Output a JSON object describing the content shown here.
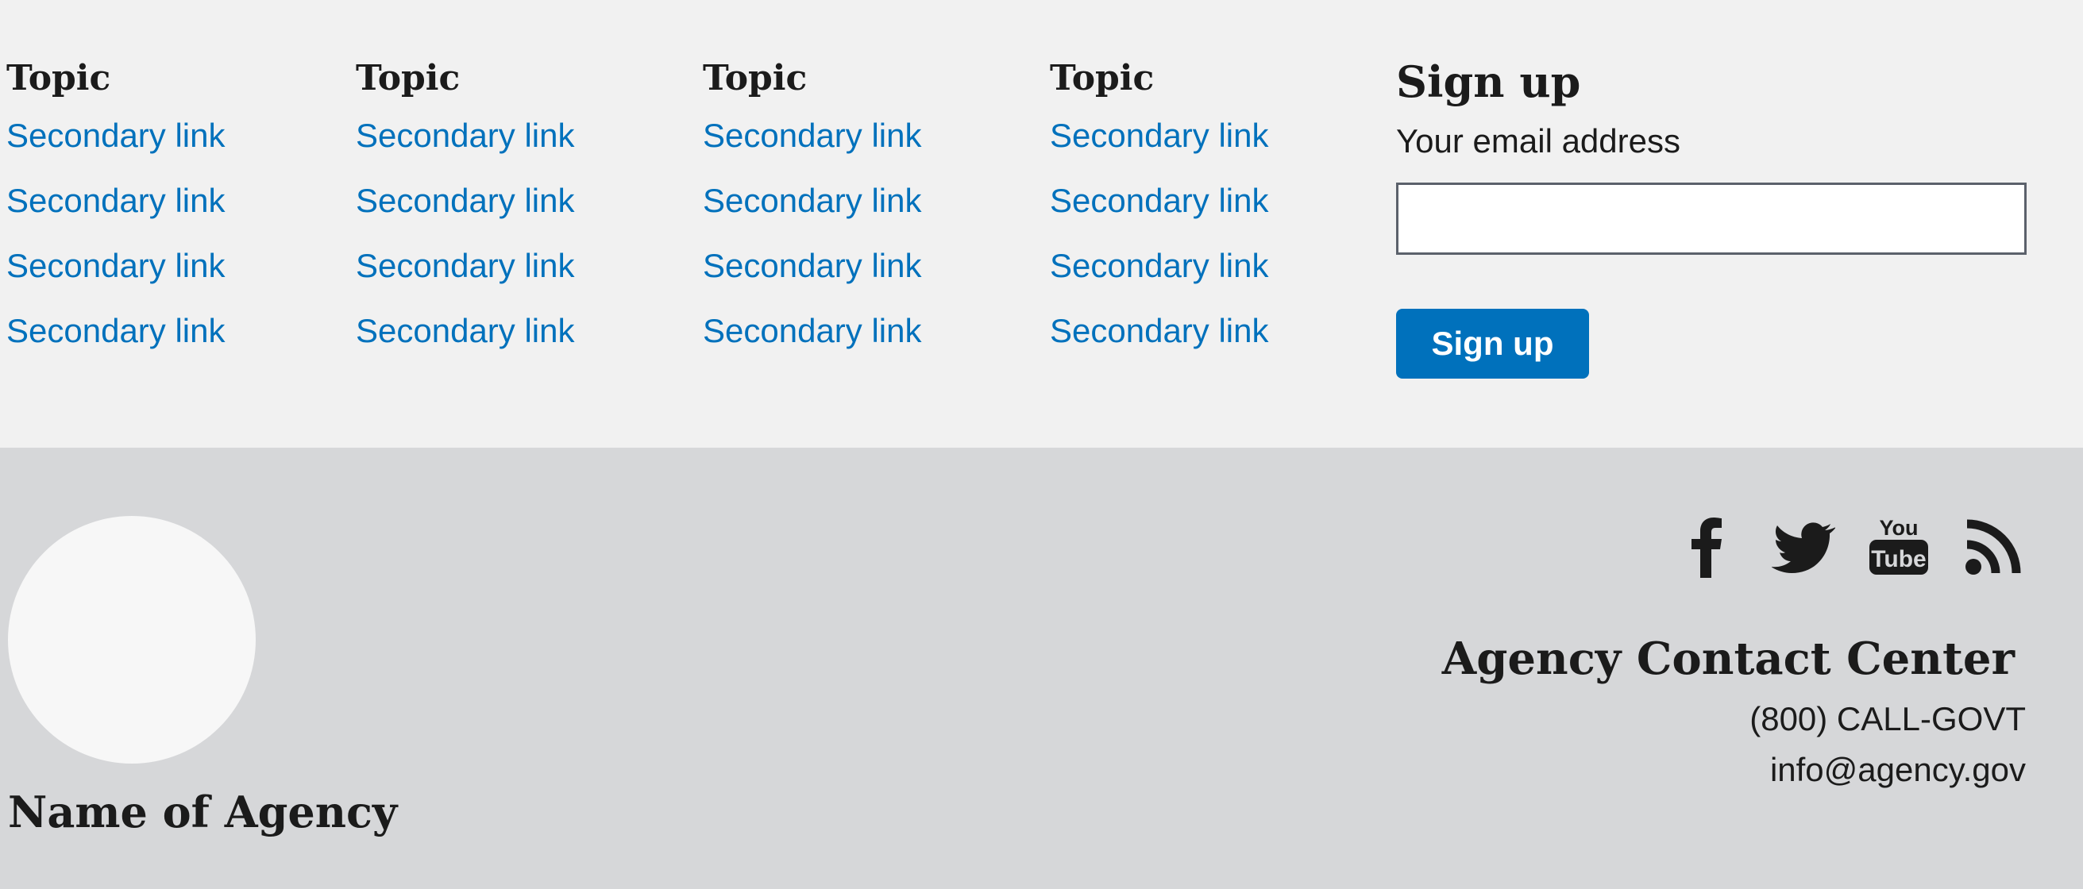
{
  "topics": [
    {
      "title": "Topic",
      "links": [
        "Secondary link",
        "Secondary link",
        "Secondary link",
        "Secondary link"
      ]
    },
    {
      "title": "Topic",
      "links": [
        "Secondary link",
        "Secondary link",
        "Secondary link",
        "Secondary link"
      ]
    },
    {
      "title": "Topic",
      "links": [
        "Secondary link",
        "Secondary link",
        "Secondary link",
        "Secondary link"
      ]
    },
    {
      "title": "Topic",
      "links": [
        "Secondary link",
        "Secondary link",
        "Secondary link",
        "Secondary link"
      ]
    }
  ],
  "signup": {
    "title": "Sign up",
    "email_label": "Your email address",
    "email_value": "",
    "button_label": "Sign up"
  },
  "agency": {
    "name": "Name of Agency"
  },
  "social": {
    "icons": [
      "facebook-icon",
      "twitter-icon",
      "youtube-icon",
      "rss-icon"
    ],
    "youtube_text_top": "You",
    "youtube_text_bottom": "Tube"
  },
  "contact": {
    "title": "Agency Contact Center",
    "phone": "(800) CALL-GOVT",
    "email": "info@agency.gov"
  },
  "colors": {
    "link": "#0071bc",
    "button": "#0071bc",
    "top_bg": "#f1f1f1",
    "bottom_bg": "#d6d7d9",
    "text": "#1b1b1b"
  }
}
